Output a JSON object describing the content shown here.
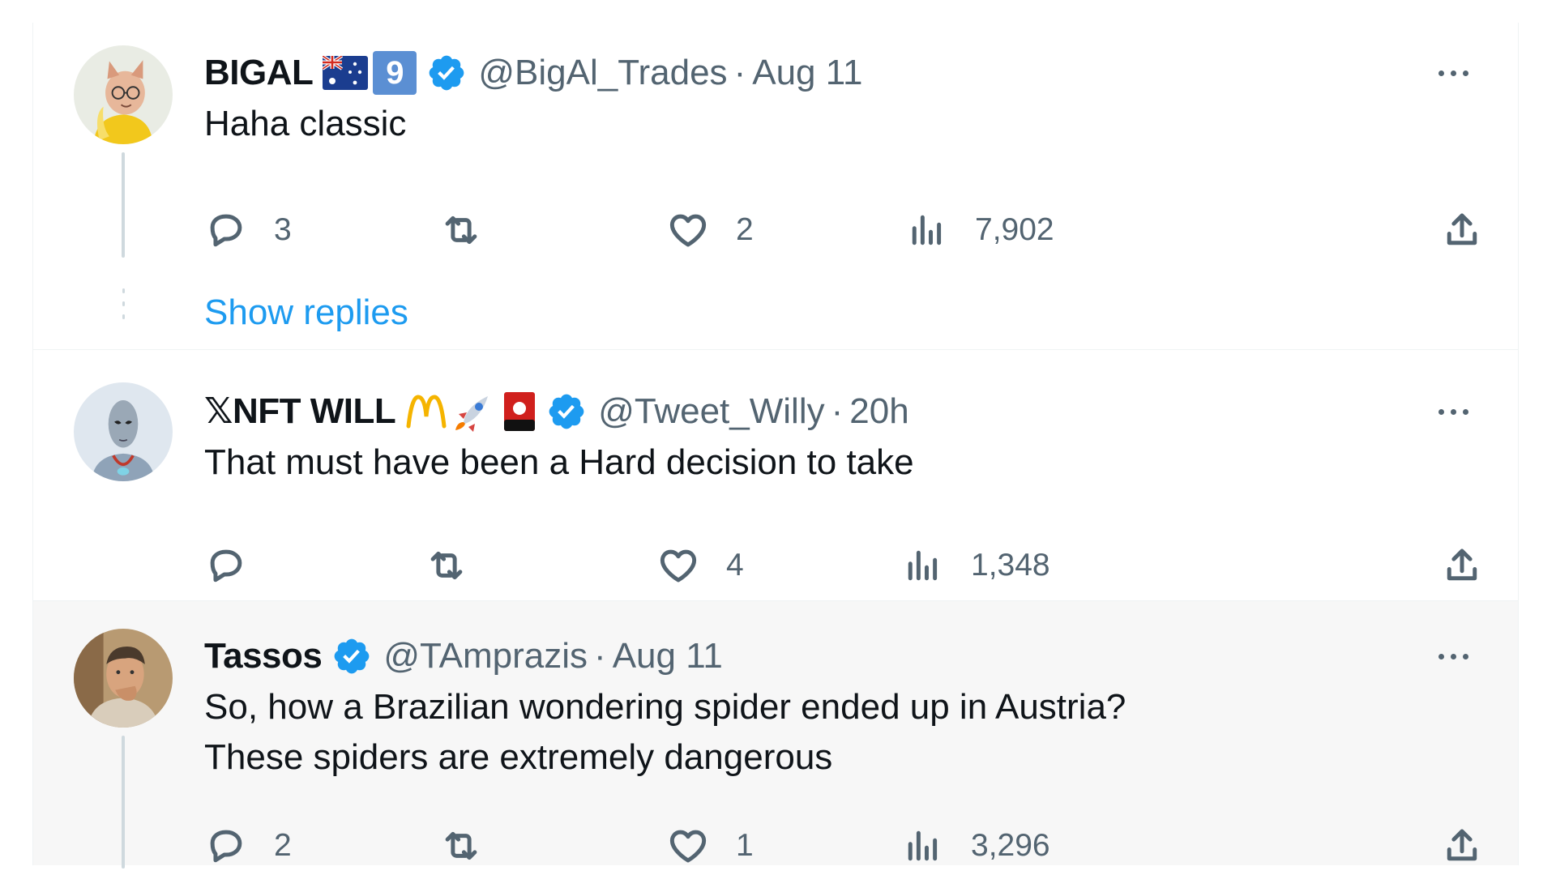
{
  "tweets": [
    {
      "name": "BIGAL",
      "badges": [
        "australia-flag-icon",
        "number-9-badge-icon",
        "verified-badge-icon"
      ],
      "badge_text": "9",
      "handle": "@BigAl_Trades",
      "separator": "·",
      "time": "Aug 11",
      "text_lines": [
        "Haha classic"
      ],
      "replies": "3",
      "reposts": "",
      "likes": "2",
      "views": "7,902",
      "show_replies_label": "Show replies"
    },
    {
      "name": "𝕏NFT WILL",
      "badges": [
        "mcdonalds-arches-icon",
        "rocket-icon",
        "red-card-icon",
        "verified-badge-icon"
      ],
      "handle": "@Tweet_Willy",
      "separator": "·",
      "time": "20h",
      "text_lines": [
        "That must have been a Hard decision to take"
      ],
      "replies": "",
      "reposts": "",
      "likes": "4",
      "views": "1,348"
    },
    {
      "name": "Tassos",
      "badges": [
        "verified-badge-icon"
      ],
      "handle": "@TAmprazis",
      "separator": "·",
      "time": "Aug 11",
      "text_lines": [
        "So, how a Brazilian wondering spider ended up in Austria?",
        "These spiders are extremely dangerous"
      ],
      "replies": "2",
      "reposts": "",
      "likes": "1",
      "views": "3,296"
    }
  ],
  "colors": {
    "accent": "#1d9bf0",
    "secondary_text": "#536471",
    "divider": "#eff3f4",
    "highlight_bg": "#f7f7f7"
  }
}
